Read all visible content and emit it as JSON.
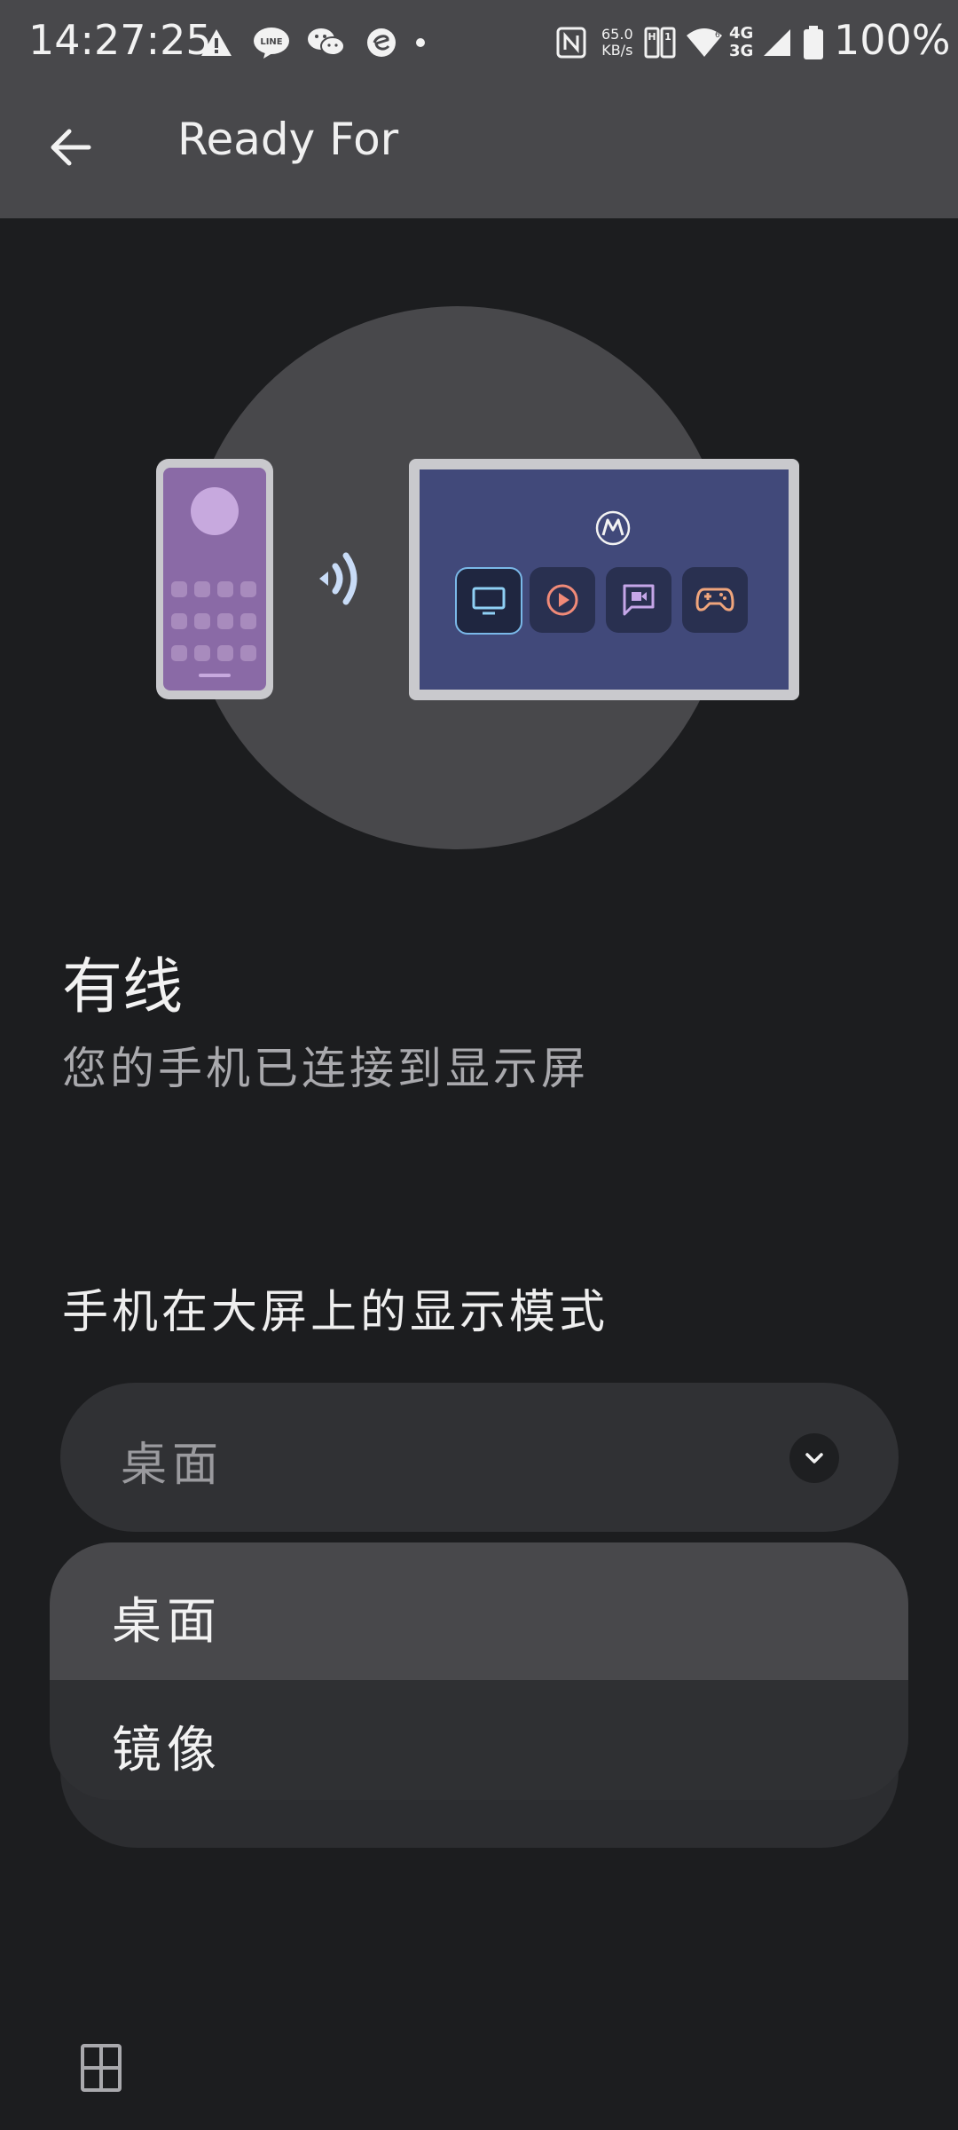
{
  "status_bar": {
    "time": "14:27:25",
    "net_speed_value": "65.0",
    "net_speed_unit": "KB/s",
    "net_type_top": "4G",
    "net_type_bottom": "3G",
    "battery_percent": "100%",
    "icons": [
      "warning-icon",
      "line-app-icon",
      "wechat-icon",
      "browser-icon",
      "dot-icon",
      "nfc-icon",
      "sim-icon",
      "wifi-icon",
      "signal-icon",
      "battery-icon"
    ]
  },
  "app_bar": {
    "title": "Ready For",
    "back_icon": "arrow-left-icon"
  },
  "illustration": {
    "tiles": [
      "tv-icon",
      "play-icon",
      "video-chat-icon",
      "gamepad-icon"
    ],
    "colors": {
      "phone_screen": "#8a6aa6",
      "tablet_screen": "#41497a",
      "circle": "#48484b"
    }
  },
  "connection": {
    "title": "有线",
    "subtitle": "您的手机已连接到显示屏"
  },
  "display_mode": {
    "label": "手机在大屏上的显示模式",
    "selected": "桌面",
    "options": [
      "桌面",
      "镜像"
    ]
  },
  "bottom": {
    "icon": "grid-icon"
  }
}
